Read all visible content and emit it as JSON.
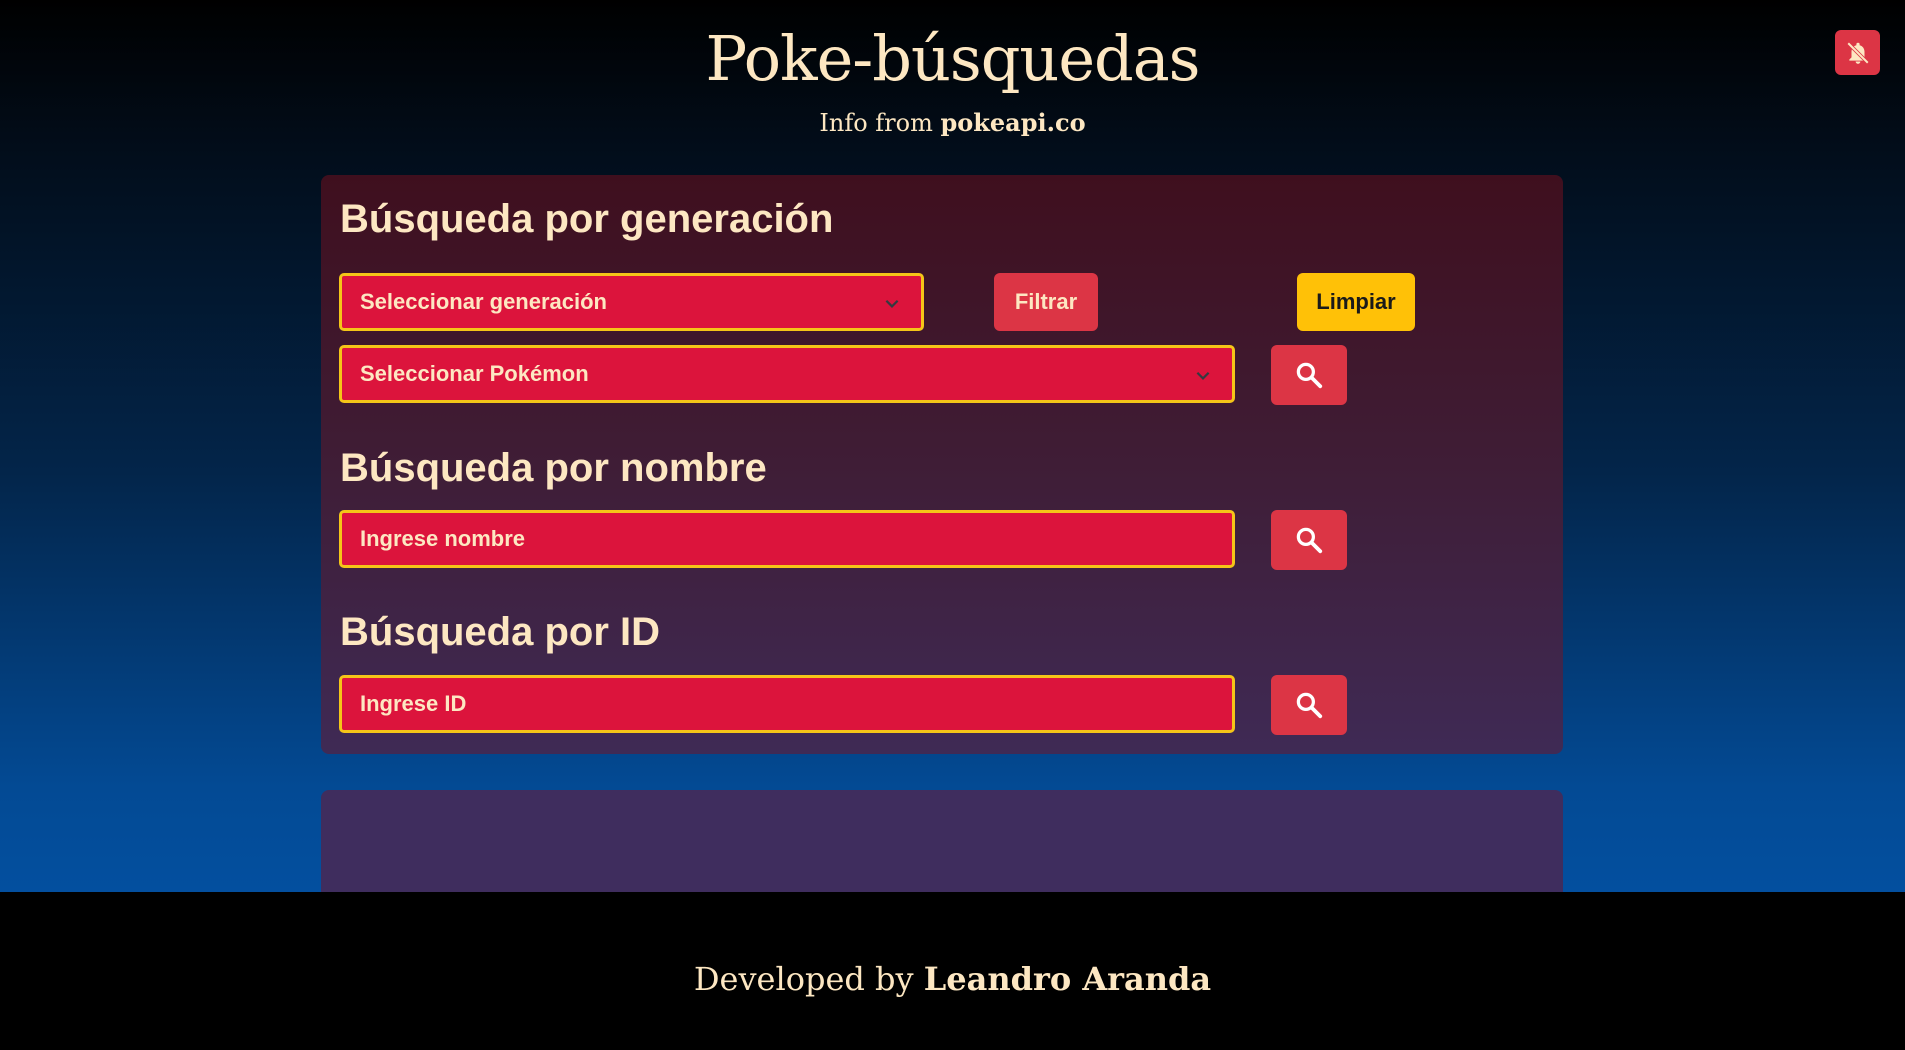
{
  "header": {
    "title": "Poke-búsquedas",
    "subtitle_prefix": "Info from ",
    "subtitle_link": "pokeapi.co"
  },
  "notifications_button": {
    "icon": "bell-slash-icon"
  },
  "generation_section": {
    "heading": "Búsqueda por generación",
    "generation_select": "Seleccionar generación",
    "filter_button": "Filtrar",
    "clear_button": "Limpiar",
    "pokemon_select": "Seleccionar Pokémon"
  },
  "name_section": {
    "heading": "Búsqueda por nombre",
    "placeholder": "Ingrese nombre"
  },
  "id_section": {
    "heading": "Búsqueda por ID",
    "placeholder": "Ingrese ID"
  },
  "footer": {
    "prefix": "Developed by ",
    "author": "Leandro Aranda"
  },
  "colors": {
    "accent_red": "#dc143c",
    "button_red": "#dc3545",
    "button_yellow": "#ffc107",
    "field_border": "#f5c518",
    "text_cream": "#fde7c2"
  }
}
